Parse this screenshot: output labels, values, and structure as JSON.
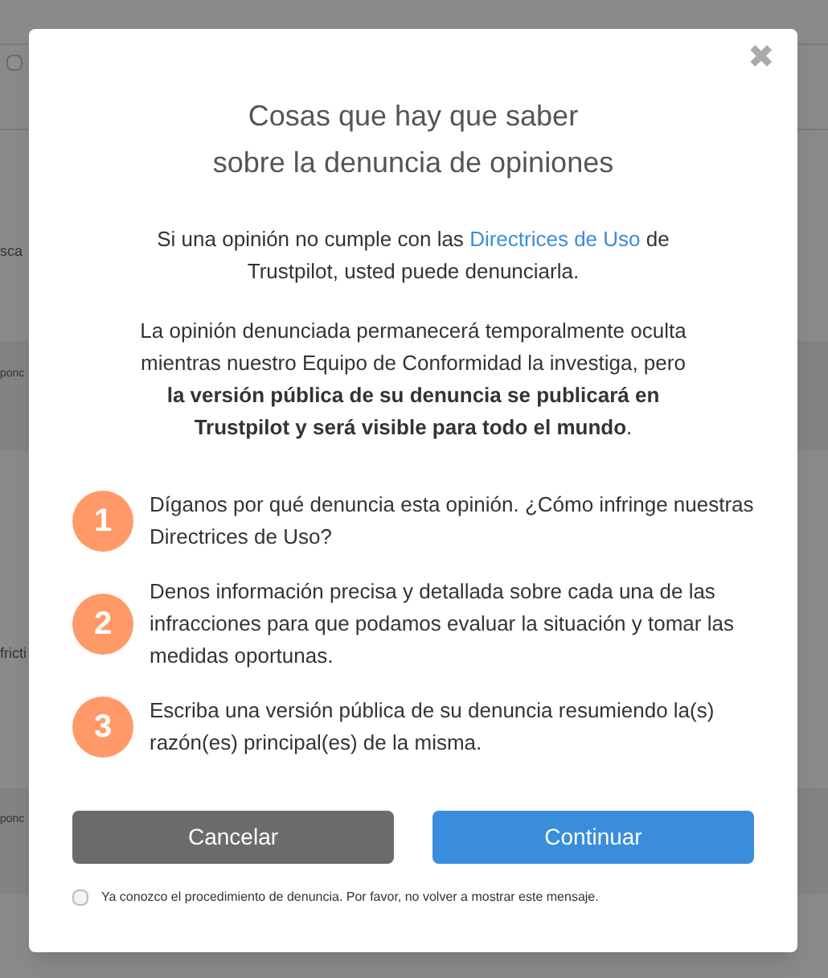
{
  "background": {
    "checkbox": {
      "checked": false
    },
    "fragments": [
      "sca",
      "ponc",
      "fricti",
      "ponc"
    ]
  },
  "dialog": {
    "close": "✖",
    "title_lines": [
      "Cosas que hay que saber",
      "sobre la denuncia de opiniones"
    ],
    "intro": {
      "before": "Si una opinión no cumple con las",
      "link": "Directrices de Uso",
      "after": "de Trustpilot, usted puede denunciarla."
    },
    "notice": "La opinión denunciada permanecerá temporalmente oculta mientras nuestro Equipo de Conformidad la investiga, pero **la versión pública de su denuncia se publicará en Trustpilot y será visible para todo el mundo**.",
    "steps": [
      {
        "number": "1",
        "text": "Díganos por qué denuncia esta opinión. ¿Cómo infringe nuestras Directrices de Uso?"
      },
      {
        "number": "2",
        "text": "Denos información precisa y detallada sobre cada una de las infracciones para que podamos evaluar la situación y tomar las medidas oportunas."
      },
      {
        "number": "3",
        "text": "Escriba una versión pública de su denuncia resumiendo la(s) razón(es) principal(es) de la misma."
      }
    ],
    "buttons": [
      {
        "kind": "secondary",
        "label": "Cancelar"
      },
      {
        "kind": "primary",
        "label": "Continuar"
      }
    ],
    "dont_show": {
      "label": "Ya conozco el procedimiento de denuncia. Por favor, no volver a mostrar este mensaje.",
      "checked": false
    }
  }
}
